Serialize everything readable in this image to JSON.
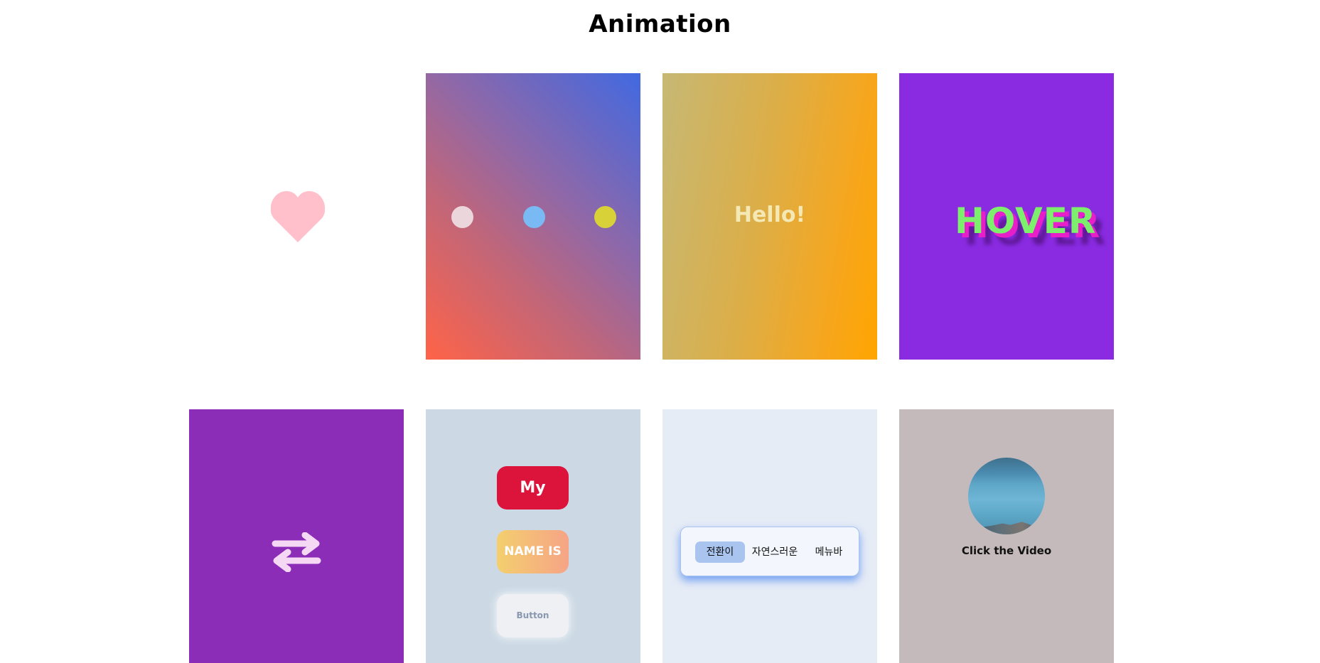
{
  "page": {
    "title": "Animation"
  },
  "cards": {
    "heart": {
      "icon": "heart-icon",
      "color": "#ffc0cb"
    },
    "dots": {
      "gradient": [
        "#ff6347",
        "#4169e1"
      ],
      "dot_colors": [
        "#ebd6db",
        "#79b9f4",
        "#d8d238"
      ]
    },
    "hello": {
      "text": "Hello!",
      "gradient": [
        "#c6b874",
        "#ffa500"
      ]
    },
    "hover": {
      "text": "HOVER",
      "background": "#8a2be2",
      "text_color": "#7cf06c",
      "shadow_color": "#e81fc8"
    },
    "swap": {
      "icon": "swap-arrows-icon",
      "background": "#8b2db6"
    },
    "buttons": {
      "items": [
        {
          "label": "My",
          "color": "#dc143c"
        },
        {
          "label": "NAME IS",
          "color": "#f4cf6e"
        },
        {
          "label": "Button",
          "color": "#eef0f3"
        }
      ]
    },
    "menu": {
      "items": [
        {
          "label": "전환이",
          "active": true
        },
        {
          "label": "자연스러운",
          "active": false
        },
        {
          "label": "메뉴바",
          "active": false
        }
      ]
    },
    "video": {
      "caption": "Click the Video"
    }
  }
}
